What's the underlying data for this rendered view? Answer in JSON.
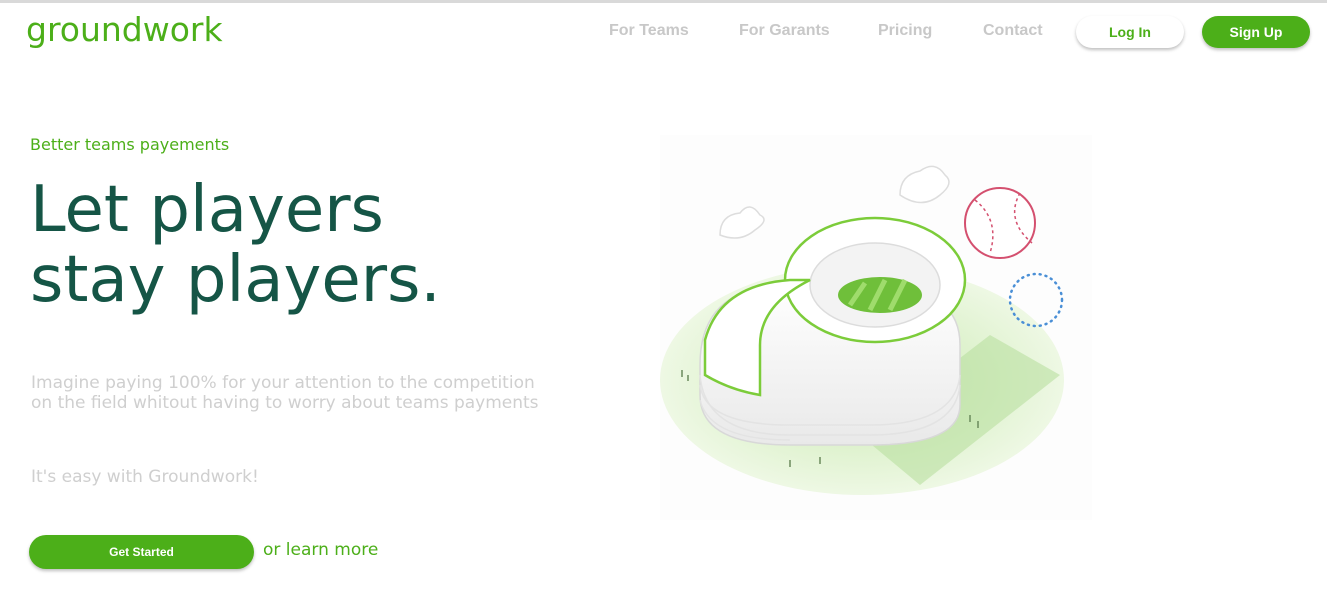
{
  "header": {
    "logo": "groundwork",
    "nav": [
      "For Teams",
      "For Garants",
      "Pricing",
      "Contact"
    ],
    "login_label": "Log In",
    "signup_label": "Sign Up"
  },
  "hero": {
    "eyebrow": "Better teams payements",
    "headline_line1": "Let players",
    "headline_line2": "stay players.",
    "description_line1": "Imagine paying 100% for your attention to the competition",
    "description_line2": "on the field whitout having to worry about teams payments",
    "easy_text": "It's easy with Groundwork!",
    "cta_label": "Get Started",
    "learn_more": "or learn more"
  },
  "colors": {
    "brand_green": "#4caf19",
    "headline_green": "#155546",
    "muted_text": "#cfcfcf"
  },
  "illustration": {
    "icon": "stadium-illustration"
  }
}
